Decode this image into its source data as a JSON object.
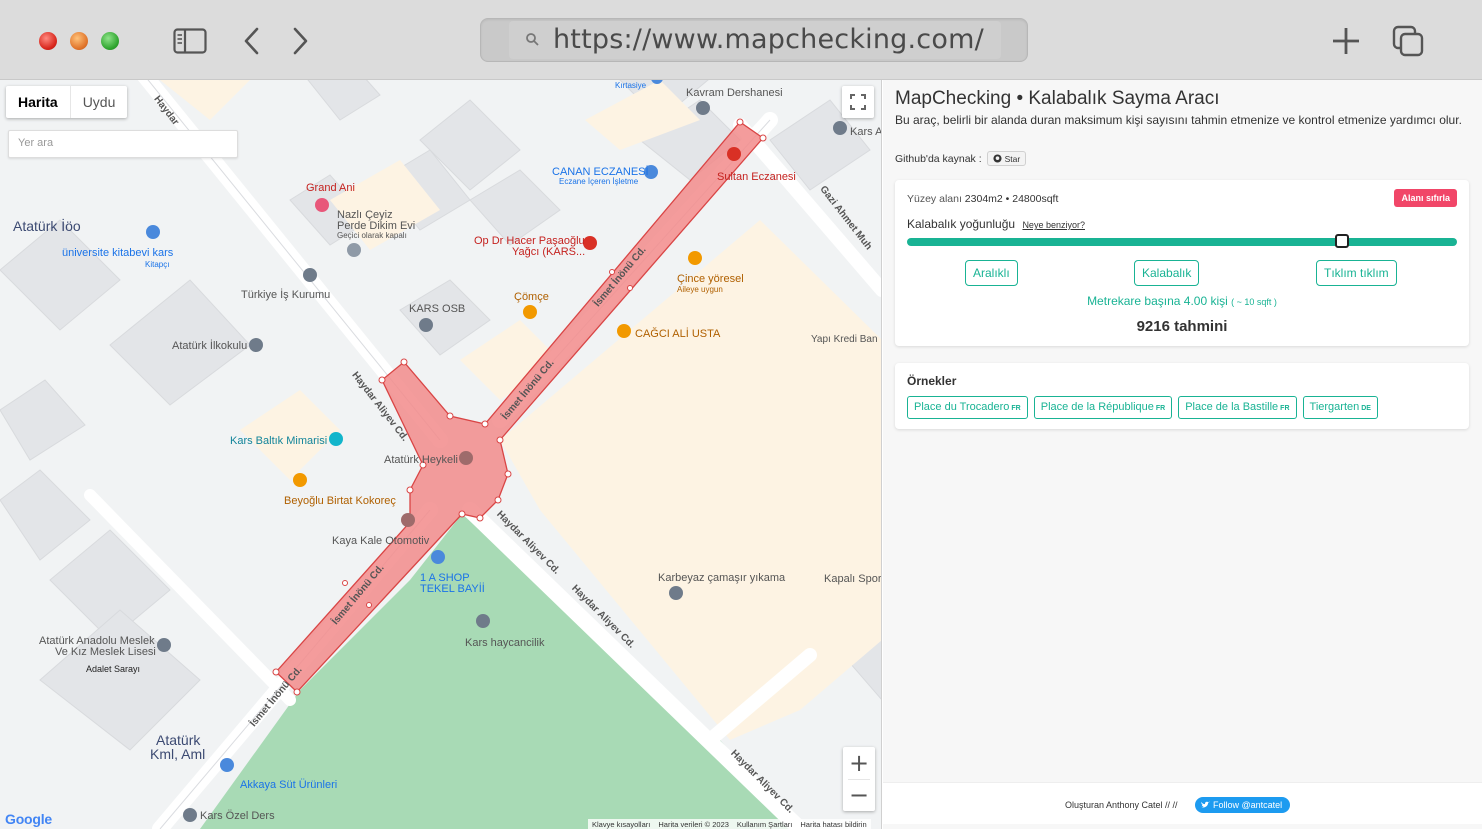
{
  "browser": {
    "url": "https://www.mapchecking.com/"
  },
  "map": {
    "type_tabs": [
      "Harita",
      "Uydu"
    ],
    "search_placeholder": "Yer ara",
    "google_label": "Google",
    "attribution": [
      "Klavye kısayolları",
      "Harita verileri © 2023",
      "Kullanım Şartları",
      "Harita hatası bildirin"
    ],
    "labels": {
      "ataturk_loo": "Atatürk İöo",
      "univ_kitabevi": "üniversite kitabevi kars",
      "kitapci": "Kitapçı",
      "turkiye_is": "Türkiye İş Kurumu",
      "ataturk_ilkokulu": "Atatürk İlkokulu",
      "kars_baltik": "Kars Baltık Mimarisi",
      "beyoglu": "Beyoğlu Birtat Kokoreç",
      "kaya_kale": "Kaya Kale Otomotiv",
      "ataturk_anadolu1": "Atatürk Anadolu Meslek",
      "ataturk_anadolu2": "Ve Kız Meslek Lisesi",
      "adalet": "Adalet Sarayı",
      "ataturk_kml1": "Atatürk",
      "ataturk_kml2": "Kml, Aml",
      "akkaya": "Akkaya Süt Ürünleri",
      "kars_ozel": "Kars Özel Ders",
      "grand_ani": "Grand Ani",
      "nazli1": "Nazlı Çeyiz",
      "nazli2": "Perde Dikim Evi",
      "nazli3": "Geçici olarak kapalı",
      "kars_osb": "KARS OSB",
      "comce": "Çömçe",
      "op_dr1": "Op Dr Hacer Paşaoğlu",
      "op_dr2": "Yağcı (KARS...",
      "canan1": "CANAN ECZANESİ",
      "canan2": "Eczane İçeren İşletme",
      "kirtasiye": "Kırtasiye",
      "kavram": "Kavram Dershanesi",
      "sultan": "Sultan Eczanesi",
      "cince1": "Çince yöresel",
      "cince2": "Aileye uygun",
      "cagci": "CAĞCI ALİ USTA",
      "yapi_kredi": "Yapı Kredi Ban",
      "kars_a": "Kars A",
      "ataturk_heykeli": "Atatürk Heykeli",
      "shop1": "1 A SHOP",
      "shop2": "TEKEL BAYİİ",
      "haycancilik": "Kars haycancilik",
      "karbeyaz": "Karbeyaz çamaşır yıkama",
      "kapali_spor": "Kapalı Spor",
      "road_haydar1": "Haydar Aliyev Cd.",
      "road_haydar_top": "Haydar",
      "road_ismet1": "İsmet İnönü Cd.",
      "road_ismet2": "İsmet İnönü Cd.",
      "road_ismet3": "İsmet İnönü Cd.",
      "road_ismet4": "İsmet İnönü Cd.",
      "road_ismet5": "İsmet İnönü Cd.",
      "road_haydar2": "Haydar Aliyev Cd.",
      "road_haydar3": "Haydar Aliyev Cd.",
      "road_haydar4": "Haydar Aliyev Cd.",
      "road_gazi": "Gazi Ahmet Muh"
    }
  },
  "panel": {
    "title": "MapChecking • Kalabalık Sayma Aracı",
    "description": "Bu araç, belirli bir alanda duran maksimum kişi sayısını tahmin etmenize ve kontrol etmenize yardımcı olur.",
    "github_label": "Github'da kaynak :",
    "star_label": "Star",
    "surface_prefix": "Yüzey alanı",
    "surface_value": "2304m2 • 24800sqft",
    "reset_label": "Alanı sıfırla",
    "density_label": "Kalabalık yoğunluğu",
    "density_link": "Neye benziyor?",
    "density_fraction": 0.79,
    "density_buttons": [
      "Aralıklı",
      "Kalabalık",
      "Tıklım tıklım"
    ],
    "per_m2": "Metrekare başına 4.00 kişi",
    "per_sqft": "( ~ 10 sqft )",
    "estimate": "9216 tahmini",
    "examples_title": "Örnekler",
    "examples": [
      {
        "name": "Place du Trocadero",
        "tag": "FR"
      },
      {
        "name": "Place de la République",
        "tag": "FR"
      },
      {
        "name": "Place de la Bastille",
        "tag": "FR"
      },
      {
        "name": "Tiergarten",
        "tag": "DE"
      }
    ],
    "footer_made": "Oluşturan Anthony Catel // //",
    "twitter_label": "Follow @antcatel"
  },
  "colors": {
    "accent": "#19b394",
    "danger": "#f14668",
    "twitter": "#1d9bf0",
    "polygon_fill": "#f28b8b",
    "polygon_stroke": "#d94545",
    "park": "#a8dab5"
  }
}
